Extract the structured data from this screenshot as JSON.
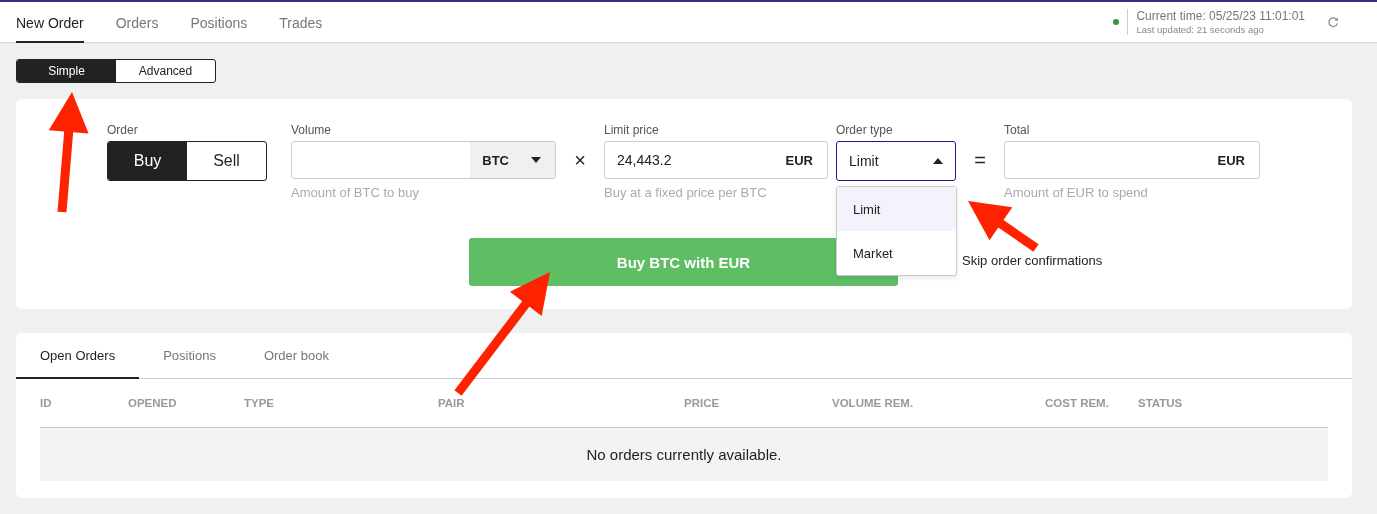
{
  "tabs": [
    {
      "label": "New Order",
      "selected": true
    },
    {
      "label": "Orders",
      "selected": false
    },
    {
      "label": "Positions",
      "selected": false
    },
    {
      "label": "Trades",
      "selected": false
    }
  ],
  "status": {
    "connected": true,
    "current_time": "Current time: 05/25/23 11:01:01",
    "last_updated": "Last updated: 21 seconds ago"
  },
  "mode_toggle": [
    {
      "label": "Simple",
      "selected": true
    },
    {
      "label": "Advanced",
      "selected": false
    }
  ],
  "order_form": {
    "side": {
      "label": "Order",
      "options": [
        {
          "label": "Buy",
          "selected": true
        },
        {
          "label": "Sell",
          "selected": false
        }
      ]
    },
    "volume": {
      "label": "Volume",
      "currency": "BTC",
      "hint": "Amount of BTC to buy"
    },
    "multiply_sign": "×",
    "limit_price": {
      "label": "Limit price",
      "value": "24,443.2",
      "currency": "EUR",
      "hint": "Buy at a fixed price per BTC"
    },
    "order_type": {
      "label": "Order type",
      "value": "Limit",
      "expanded": true,
      "options": [
        {
          "label": "Limit",
          "selected": true
        },
        {
          "label": "Market",
          "selected": false
        }
      ]
    },
    "equals_sign": "=",
    "total": {
      "label": "Total",
      "currency": "EUR",
      "hint": "Amount of EUR to spend"
    },
    "submit": "Buy BTC with EUR",
    "skip_confirmations": "Skip order confirmations"
  },
  "orders_panel": {
    "tabs": [
      {
        "label": "Open Orders",
        "selected": true
      },
      {
        "label": "Positions",
        "selected": false
      },
      {
        "label": "Order book",
        "selected": false
      }
    ],
    "columns": [
      "ID",
      "OPENED",
      "TYPE",
      "PAIR",
      "PRICE",
      "VOLUME REM.",
      "COST REM.",
      "STATUS"
    ],
    "empty_message": "No orders currently available."
  },
  "annotations": [
    {
      "kind": "arrow"
    },
    {
      "kind": "arrow"
    },
    {
      "kind": "arrow"
    }
  ]
}
